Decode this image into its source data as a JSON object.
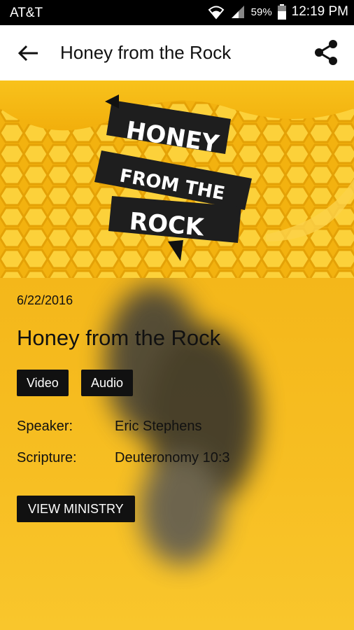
{
  "status": {
    "carrier": "AT&T",
    "battery": "59%",
    "time": "12:19 PM"
  },
  "appbar": {
    "title": "Honey from the Rock"
  },
  "banner": {
    "line1": "HONEY",
    "line2": "FROM THE",
    "line3": "ROCK"
  },
  "sermon": {
    "date": "6/22/2016",
    "title": "Honey from the Rock",
    "media": [
      "Video",
      "Audio"
    ],
    "speaker_label": "Speaker:",
    "speaker": "Eric Stephens",
    "scripture_label": "Scripture:",
    "scripture": "Deuteronomy 10:3",
    "ministry_button": "VIEW MINISTRY"
  },
  "colors": {
    "accent": "#f5bb1c",
    "dark": "#111111"
  }
}
